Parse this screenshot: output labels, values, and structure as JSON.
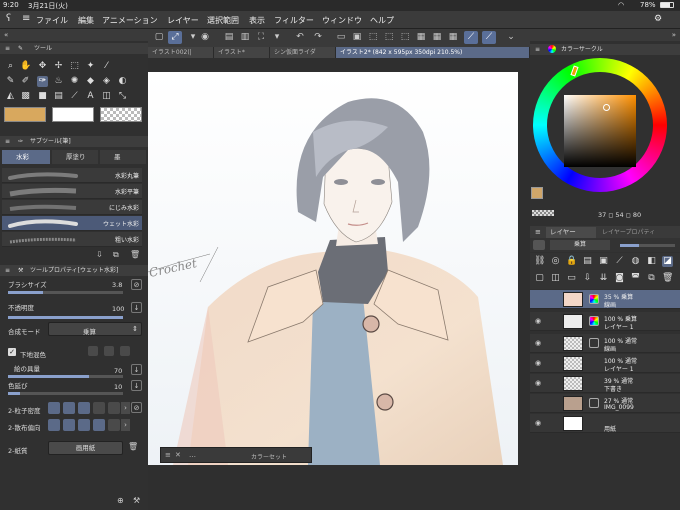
{
  "status": {
    "time": "9:20",
    "date": "3月21日(火)",
    "battery": "78%"
  },
  "menu": {
    "items": [
      "ファイル",
      "編集",
      "アニメーション",
      "レイヤー",
      "選択範囲",
      "表示",
      "フィルター",
      "ウィンドウ",
      "ヘルプ"
    ]
  },
  "tabs": [
    {
      "label": "イラスト002(|",
      "active": false
    },
    {
      "label": "イラスト*",
      "active": false
    },
    {
      "label": "シン仮面ライダ",
      "active": false
    },
    {
      "label": "イラスト2* (842 x 595px 350dpi 210.5%)",
      "active": true
    }
  ],
  "tool_panel": {
    "title": "ツール"
  },
  "subtool_panel": {
    "title": "サブツール[筆]",
    "tabs": [
      "水彩",
      "厚塗り",
      "墨"
    ],
    "brushes": [
      {
        "name": "水彩丸筆",
        "selected": false
      },
      {
        "name": "水彩平筆",
        "selected": false
      },
      {
        "name": "にじみ水彩",
        "selected": false
      },
      {
        "name": "ウェット水彩",
        "selected": true
      },
      {
        "name": "粗い水彩",
        "selected": false
      }
    ]
  },
  "tool_property": {
    "title": "ツールプロパティ[ウェット水彩]",
    "brush_size_label": "ブラシサイズ",
    "brush_size_value": "3.8",
    "opacity_label": "不透明度",
    "opacity_value": "100",
    "blend_label": "合成モード",
    "blend_value": "乗算",
    "underlay_label": "下地混色",
    "paint_amount_label": "絵の具量",
    "paint_amount_value": "70",
    "color_stretch_label": "色延び",
    "color_stretch_value": "10",
    "grain_density_label": "2-粒子密度",
    "scatter_label": "2-散布偏向",
    "paper_label": "2-紙質",
    "paper_value": "画用紙"
  },
  "color_circle": {
    "title": "カラーサークル",
    "h": "37",
    "s": "54",
    "v": "80",
    "main_color": "#cfa66a"
  },
  "layer_panel": {
    "tab1": "レイヤー",
    "tab2": "レイヤープロパティ",
    "blend_mode": "乗算",
    "layers": [
      {
        "line1": "35 % 乗算",
        "line2": "線画",
        "selected": true
      },
      {
        "line1": "100 % 乗算",
        "line2": "レイヤー 1",
        "selected": false
      },
      {
        "line1": "100 % 通常",
        "line2": "線画",
        "selected": false
      },
      {
        "line1": "100 % 通常",
        "line2": "レイヤー 1",
        "selected": false
      },
      {
        "line1": "39 % 通常",
        "line2": "下書き",
        "selected": false
      },
      {
        "line1": "27 % 通常",
        "line2": "IMG_0099",
        "selected": false
      },
      {
        "line1": "",
        "line2": "用紙",
        "selected": false
      }
    ]
  },
  "color_set": {
    "title": "カラーセット"
  },
  "sketch_text": "Crochet"
}
